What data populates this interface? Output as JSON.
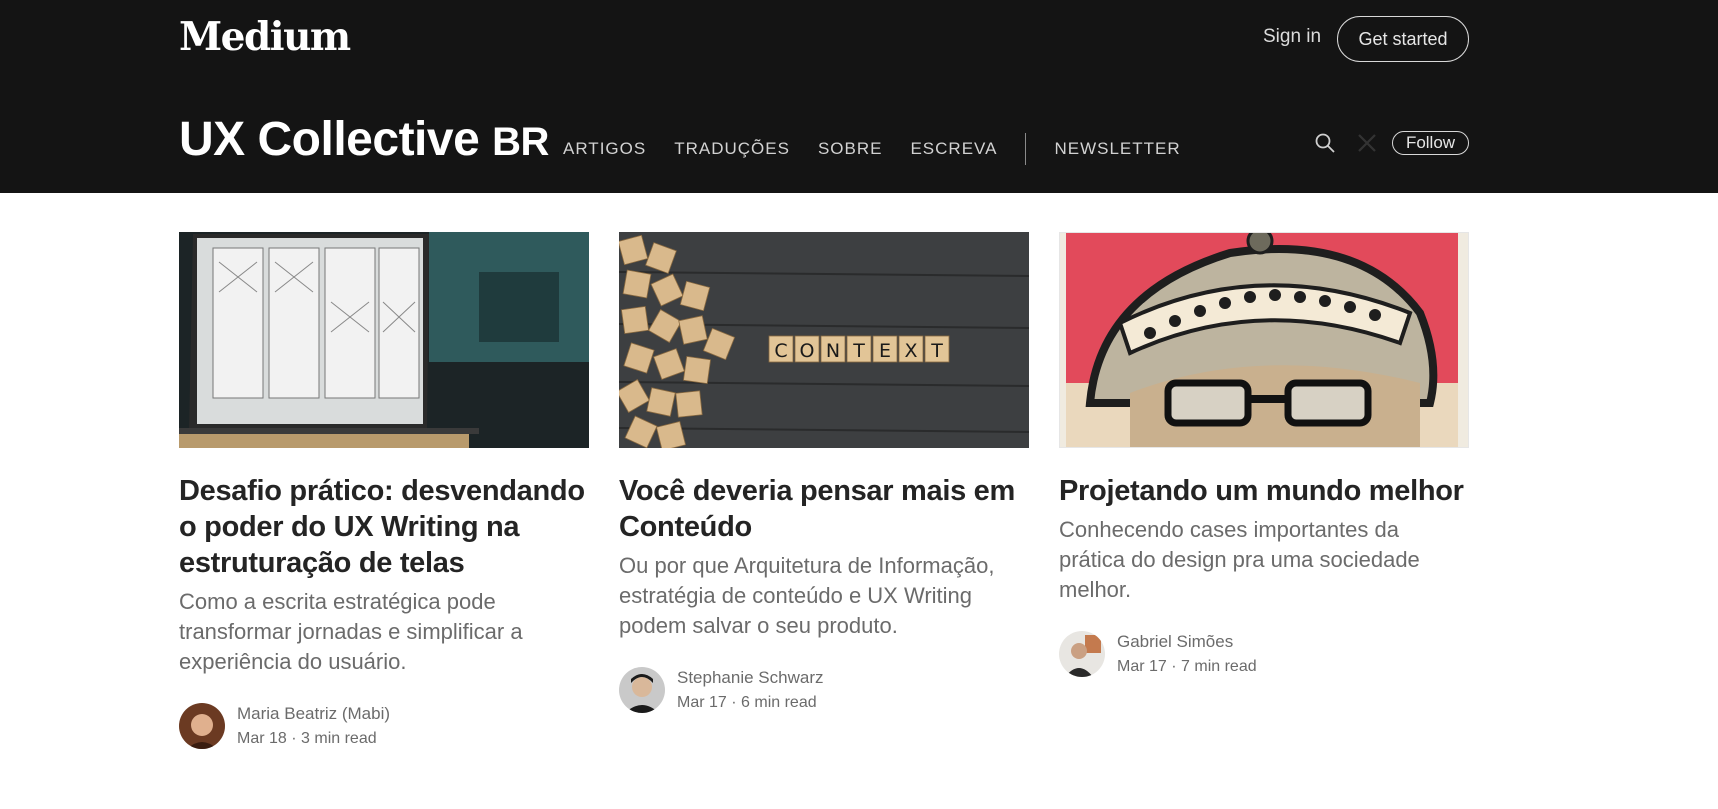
{
  "header": {
    "logo": "Medium",
    "sign_in": "Sign in",
    "get_started": "Get started"
  },
  "publication": {
    "name": "UX Collective",
    "suffix": "BR",
    "nav": [
      "ARTIGOS",
      "TRADUÇÕES",
      "SOBRE",
      "ESCREVA"
    ],
    "nav_after": "NEWSLETTER",
    "follow": "Follow",
    "icons": [
      "search-icon",
      "x-icon"
    ]
  },
  "articles": [
    {
      "title": "Desafio prático: desvendando o poder do UX Writing na estruturação de telas",
      "subtitle": "Como a escrita estratégica pode transformar jornadas e simplificar a experiência do usuário.",
      "author": "Maria Beatriz (Mabi)",
      "date": "Mar 18",
      "read": "3 min read"
    },
    {
      "title": "Você deveria pensar mais em Conteúdo",
      "subtitle": "Ou por que Arquitetura de Informação, estratégia de conteúdo e UX Writing podem salvar o seu produto.",
      "author": "Stephanie Schwarz",
      "date": "Mar 17",
      "read": "6 min read",
      "thumb_word": [
        "C",
        "O",
        "N",
        "T",
        "E",
        "X",
        "T"
      ]
    },
    {
      "title": "Projetando um mundo melhor",
      "subtitle": "Conhecendo cases importantes da prática do design pra uma sociedade melhor.",
      "author": "Gabriel Simões",
      "date": "Mar 17",
      "read": "7 min read"
    }
  ],
  "colors": {
    "header_bg": "#141414",
    "accent_red": "#e24a5b"
  }
}
